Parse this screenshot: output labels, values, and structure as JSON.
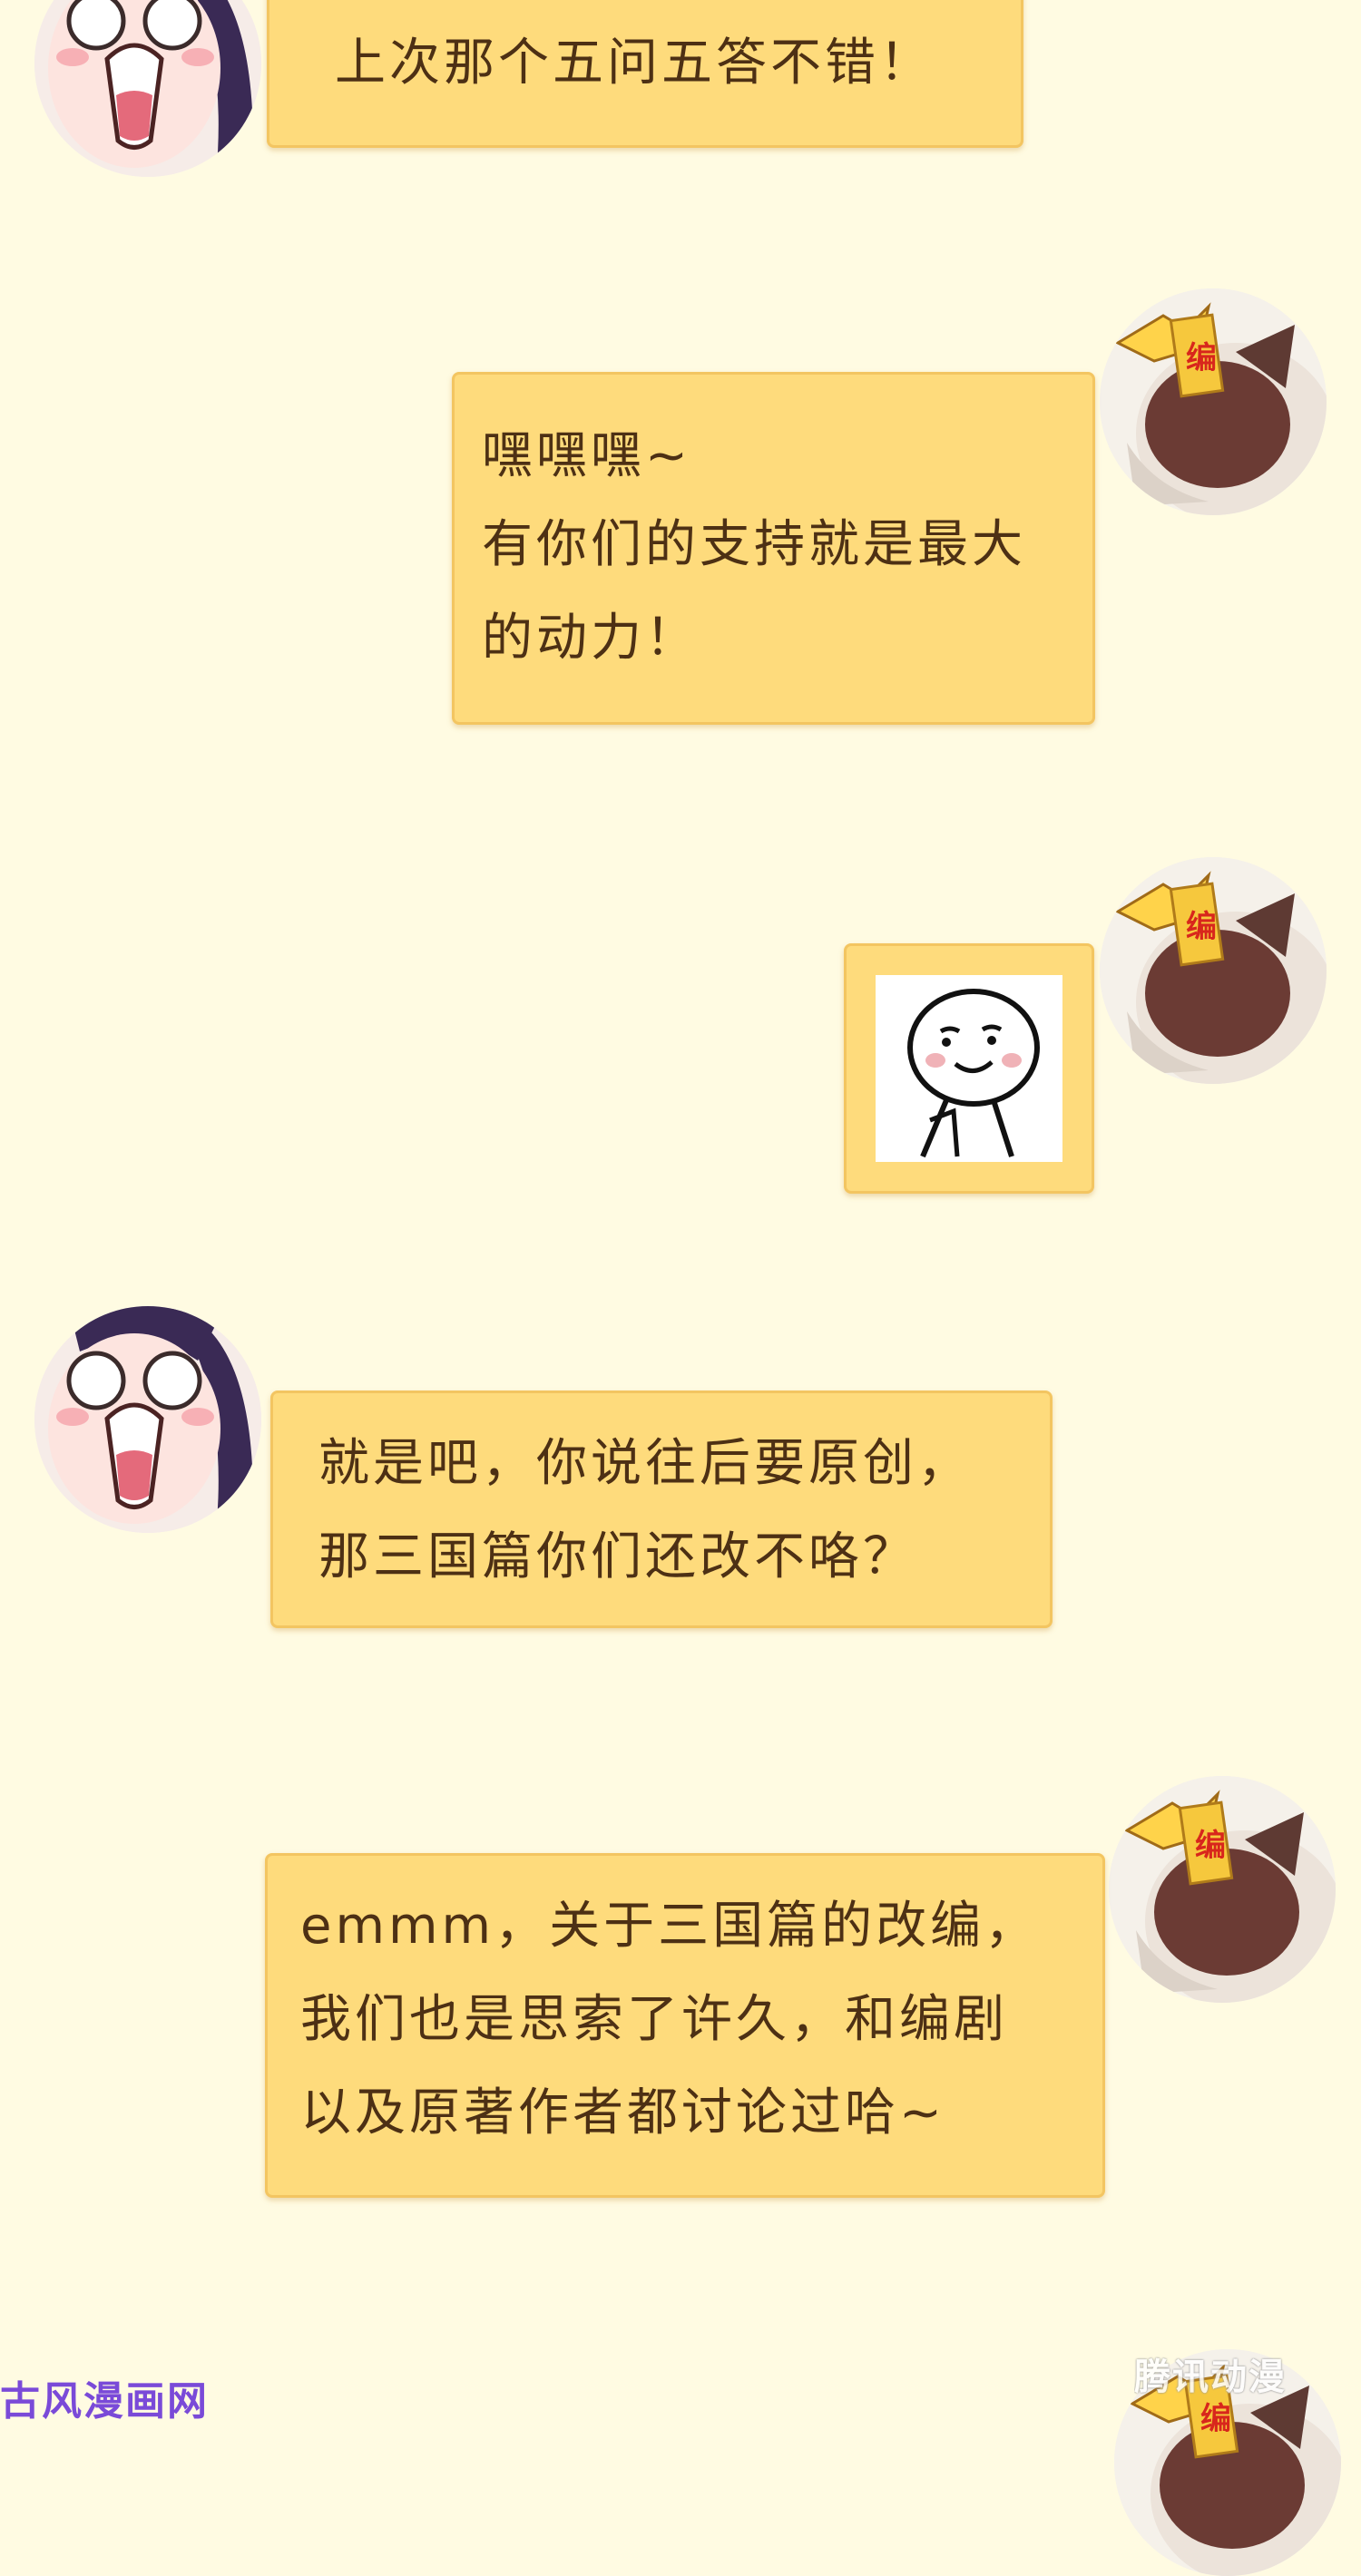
{
  "messages": [
    {
      "sender": "girl",
      "lines": [
        "上次那个五问五答不错！"
      ]
    },
    {
      "sender": "editor",
      "avatar_badge": "编",
      "lines": [
        "嘿嘿嘿~",
        "有你们的支持就是最大",
        "的动力！"
      ]
    },
    {
      "sender": "editor",
      "avatar_badge": "编",
      "sticker": "smirk-face-sticker"
    },
    {
      "sender": "girl",
      "lines": [
        "就是吧，你说往后要原创，",
        "那三国篇你们还改不咯？"
      ]
    },
    {
      "sender": "editor",
      "avatar_badge": "编",
      "lines": [
        "emmm，关于三国篇的改编，",
        "我们也是思索了许久，和编剧",
        "以及原著作者都讨论过哈~"
      ]
    },
    {
      "sender": "editor",
      "avatar_badge": "编"
    }
  ],
  "watermarks": {
    "left": "古风漫画网",
    "right": "腾讯动漫"
  },
  "colors": {
    "background": "#fffbe2",
    "bubble_fill": "#fedb7c",
    "bubble_border": "#f3c561",
    "text": "#4d3014",
    "badge_text": "#d8261c"
  }
}
